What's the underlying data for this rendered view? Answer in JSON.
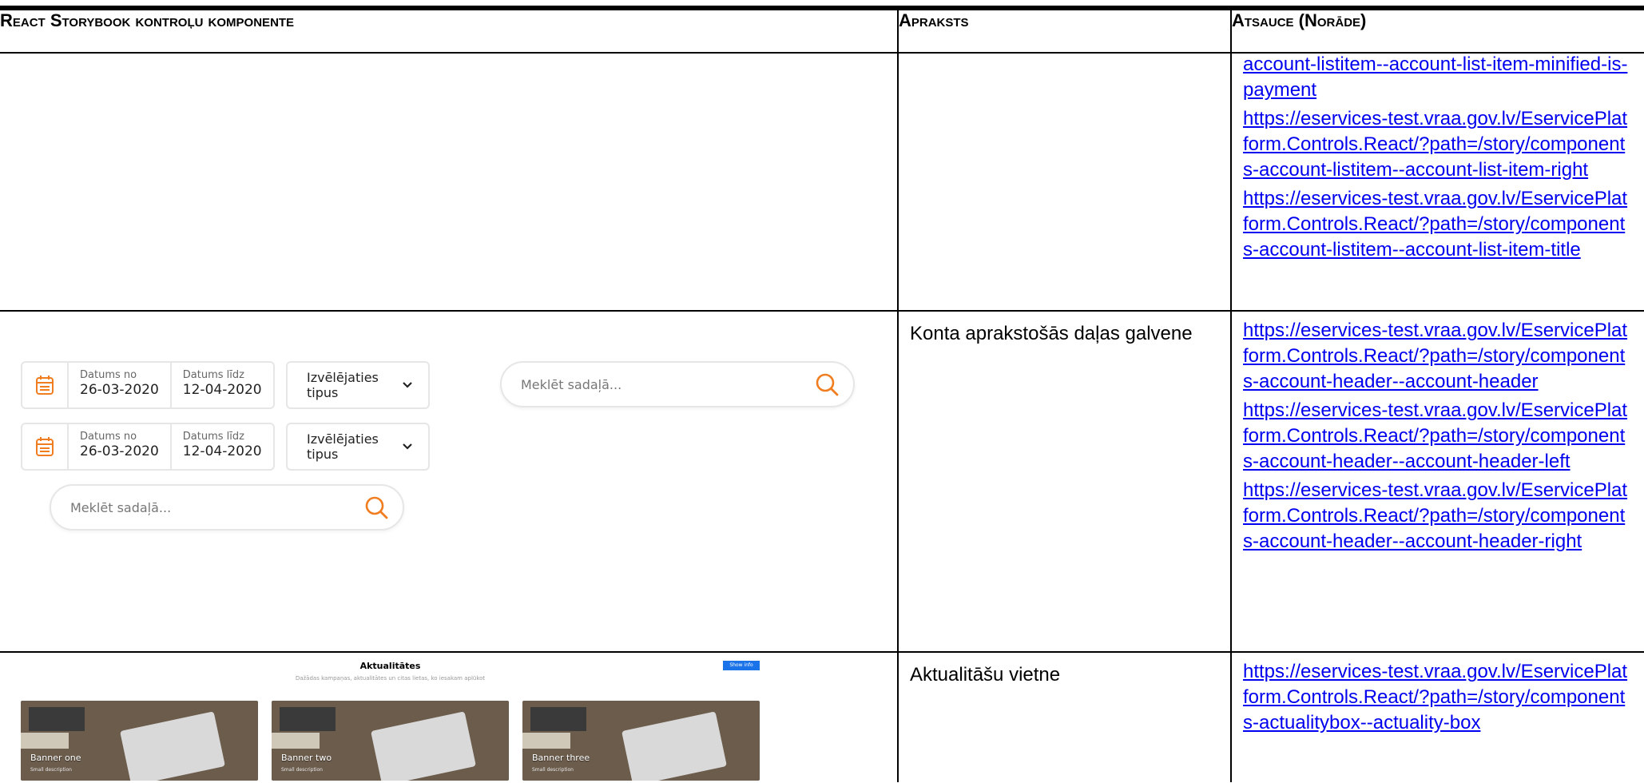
{
  "table": {
    "headers": {
      "component": "React Storybook kontroļu komponente",
      "description": "Apraksts",
      "reference": "Atsauce (Norāde)"
    },
    "rows": [
      {
        "description": "",
        "links": [
          "account-listitem--account-list-item-minified-is-payment",
          "https://eservices-test.vraa.gov.lv/EservicePlatform.Controls.React/?path=/story/components-account-listitem--account-list-item-right",
          "https://eservices-test.vraa.gov.lv/EservicePlatform.Controls.React/?path=/story/components-account-listitem--account-list-item-title"
        ]
      },
      {
        "description": "Konta aprakstošās daļas galvene",
        "links": [
          "https://eservices-test.vraa.gov.lv/EservicePlatform.Controls.React/?path=/story/components-account-header--account-header",
          "https://eservices-test.vraa.gov.lv/EservicePlatform.Controls.React/?path=/story/components-account-header--account-header-left",
          "https://eservices-test.vraa.gov.lv/EservicePlatform.Controls.React/?path=/story/components-account-header--account-header-right"
        ]
      },
      {
        "description": "Aktualitāšu vietne",
        "links": [
          "https://eservices-test.vraa.gov.lv/EservicePlatform.Controls.React/?path=/story/components-actualitybox--actuality-box"
        ]
      }
    ]
  },
  "header_widget": {
    "date_from_label": "Datums no",
    "date_from_value": "26-03-2020",
    "date_to_label": "Datums līdz",
    "date_to_value": "12-04-2020",
    "type_select": "Izvēlējaties tipus",
    "search_placeholder": "Meklēt sadaļā..."
  },
  "actuality_widget": {
    "title": "Aktualitātes",
    "subtitle": "Dažādas kampaņas, aktualitātes un citas lietas, ko iesakam aplūkot",
    "button": "Show info",
    "banners": [
      {
        "title": "Banner one",
        "desc": "Small description"
      },
      {
        "title": "Banner two",
        "desc": "Small description"
      },
      {
        "title": "Banner three",
        "desc": "Small description"
      }
    ]
  },
  "colors": {
    "link": "#0000ee",
    "accent": "#f07d1f",
    "button": "#1a73e8"
  }
}
